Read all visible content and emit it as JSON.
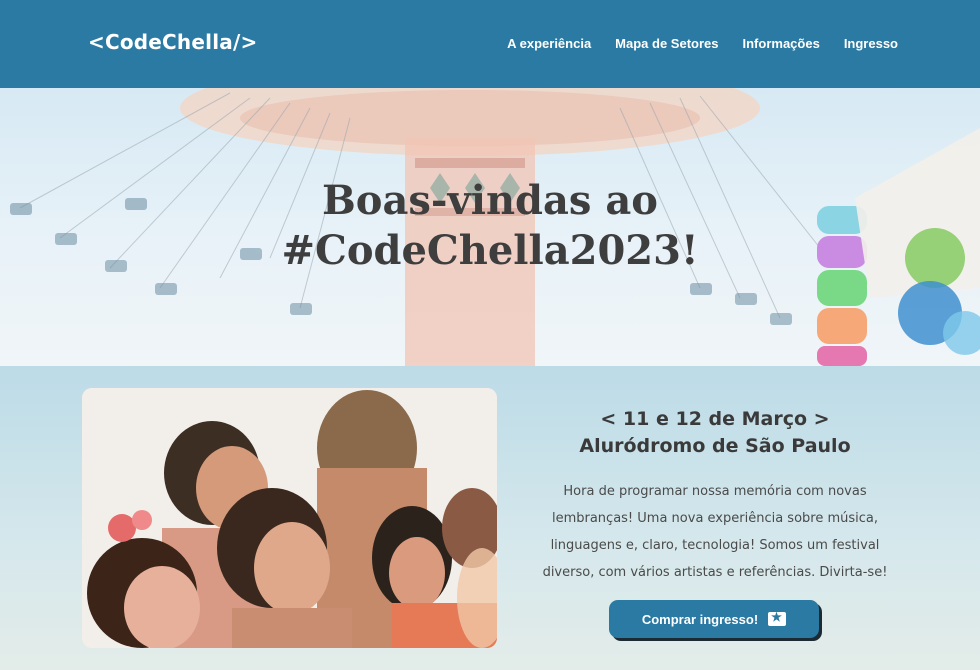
{
  "header": {
    "logo": "<CodeChella/>",
    "nav": [
      {
        "label": "A experiência"
      },
      {
        "label": "Mapa de Setores"
      },
      {
        "label": "Informações"
      },
      {
        "label": "Ingresso"
      }
    ]
  },
  "hero": {
    "title_line1": "Boas-vindas ao",
    "title_line2": "#CodeChella2023!"
  },
  "event": {
    "date": "< 11 e 12 de Março >",
    "venue": "Aluródromo de São Paulo",
    "description_lines": [
      "Hora de programar nossa memória com novas",
      "lembranças! Uma nova experiência sobre música,",
      "linguagens e, claro, tecnologia! Somos um festival",
      "diverso, com vários artistas e referências. Divirta-se!"
    ],
    "buy_label": "Comprar ingresso!",
    "buy_icon": "ticket-star-icon"
  },
  "colors": {
    "brand": "#2b7aa3",
    "title_text": "#3e3e3e",
    "button_shadow": "#1b2a33"
  }
}
